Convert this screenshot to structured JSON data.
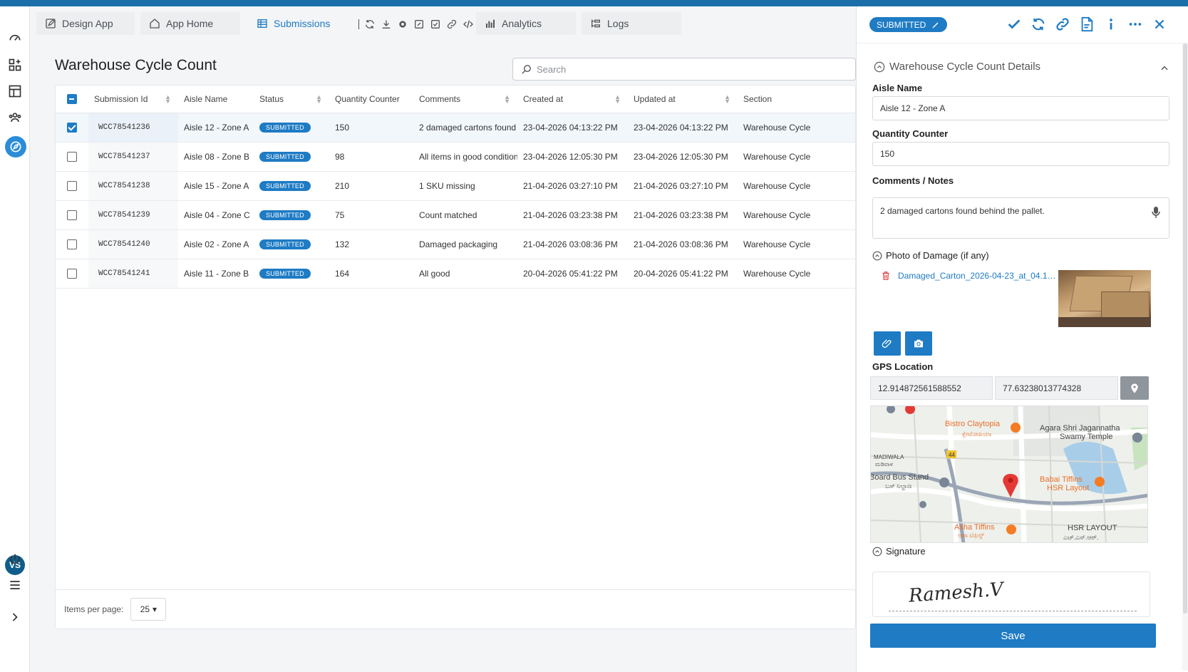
{
  "tabs": {
    "design_app": "Design App",
    "app_home": "App Home",
    "submissions": "Submissions",
    "analytics": "Analytics",
    "logs": "Logs"
  },
  "page": {
    "title": "Warehouse Cycle Count",
    "search_placeholder": "Search"
  },
  "table": {
    "columns": [
      "Submission Id",
      "Aisle Name",
      "Status",
      "Quantity Counter",
      "Comments",
      "Created at",
      "Updated at",
      "Section"
    ],
    "rows": [
      {
        "id": "WCC78541236",
        "aisle": "Aisle 12 - Zone A",
        "status": "SUBMITTED",
        "qty": "150",
        "comments": "2 damaged cartons found",
        "created": "23-04-2026 04:13:22 PM",
        "updated": "23-04-2026 04:13:22 PM",
        "section": "Warehouse Cycle"
      },
      {
        "id": "WCC78541237",
        "aisle": "Aisle 08 - Zone B",
        "status": "SUBMITTED",
        "qty": "98",
        "comments": "All items in good condition",
        "created": "23-04-2026 12:05:30 PM",
        "updated": "23-04-2026 12:05:30 PM",
        "section": "Warehouse Cycle"
      },
      {
        "id": "WCC78541238",
        "aisle": "Aisle 15 - Zone A",
        "status": "SUBMITTED",
        "qty": "210",
        "comments": "1 SKU missing",
        "created": "21-04-2026 03:27:10 PM",
        "updated": "21-04-2026 03:27:10 PM",
        "section": "Warehouse Cycle"
      },
      {
        "id": "WCC78541239",
        "aisle": "Aisle 04 - Zone C",
        "status": "SUBMITTED",
        "qty": "75",
        "comments": "Count matched",
        "created": "21-04-2026 03:23:38 PM",
        "updated": "21-04-2026 03:23:38 PM",
        "section": "Warehouse Cycle"
      },
      {
        "id": "WCC78541240",
        "aisle": "Aisle 02 - Zone A",
        "status": "SUBMITTED",
        "qty": "132",
        "comments": "Damaged packaging",
        "created": "21-04-2026 03:08:36 PM",
        "updated": "21-04-2026 03:08:36 PM",
        "section": "Warehouse Cycle"
      },
      {
        "id": "WCC78541241",
        "aisle": "Aisle 11 - Zone B",
        "status": "SUBMITTED",
        "qty": "164",
        "comments": "All good",
        "created": "20-04-2026 05:41:22 PM",
        "updated": "20-04-2026 05:41:22 PM",
        "section": "Warehouse Cycle"
      }
    ],
    "selected_row": 0
  },
  "footer": {
    "items_per_page_label": "Items per page:",
    "items_per_page_value": "25"
  },
  "user": {
    "initials": "VS"
  },
  "panel": {
    "status": "SUBMITTED",
    "section_title": "Warehouse Cycle Count Details",
    "aisle_label": "Aisle Name",
    "aisle_value": "Aisle 12 - Zone A",
    "qty_label": "Quantity Counter",
    "qty_value": "150",
    "comments_label": "Comments / Notes",
    "comments_value": "2 damaged cartons found behind the pallet.",
    "photo_label": "Photo of Damage (if any)",
    "photo_file": "Damaged_Carton_2026-04-23_at_04.1…",
    "gps_label": "GPS Location",
    "gps_lat": "12.914872561588552",
    "gps_lng": "77.63238013774328",
    "signature_label": "Signature",
    "signature_text": "Ramesh.V",
    "save_label": "Save"
  },
  "map": {
    "labels": {
      "bistro": "Bistro Claytopia",
      "bistro_kn": "ಕ್ಲೇಟೋಪಿಯಾ",
      "temple1": "Agara Shri Jagannatha",
      "temple2": "Swamy Temple",
      "madiwala": "MADIWALA",
      "madiwala_kn": "ಮಡಿವಾಳ",
      "busstand": "Board Bus Stand",
      "busstand_kn": "ಬಸ್ ನಿಲ್ದಾಣ",
      "babai1": "Babai Tiffins",
      "babai2": "HSR Layout",
      "asha": "Asha Tiffins",
      "asha_kn": "ಆಶಾ ಟಿಫಿನ್ಸ್",
      "hsr": "HSR LAYOUT",
      "hsr_kn": "ಎಚ್.ಎಸ್.ಆರ್.",
      "road44": "44"
    }
  },
  "colors": {
    "accent": "#1e7bc4",
    "topstripe": "#1b6fa8",
    "map_pin": "#e53935"
  }
}
